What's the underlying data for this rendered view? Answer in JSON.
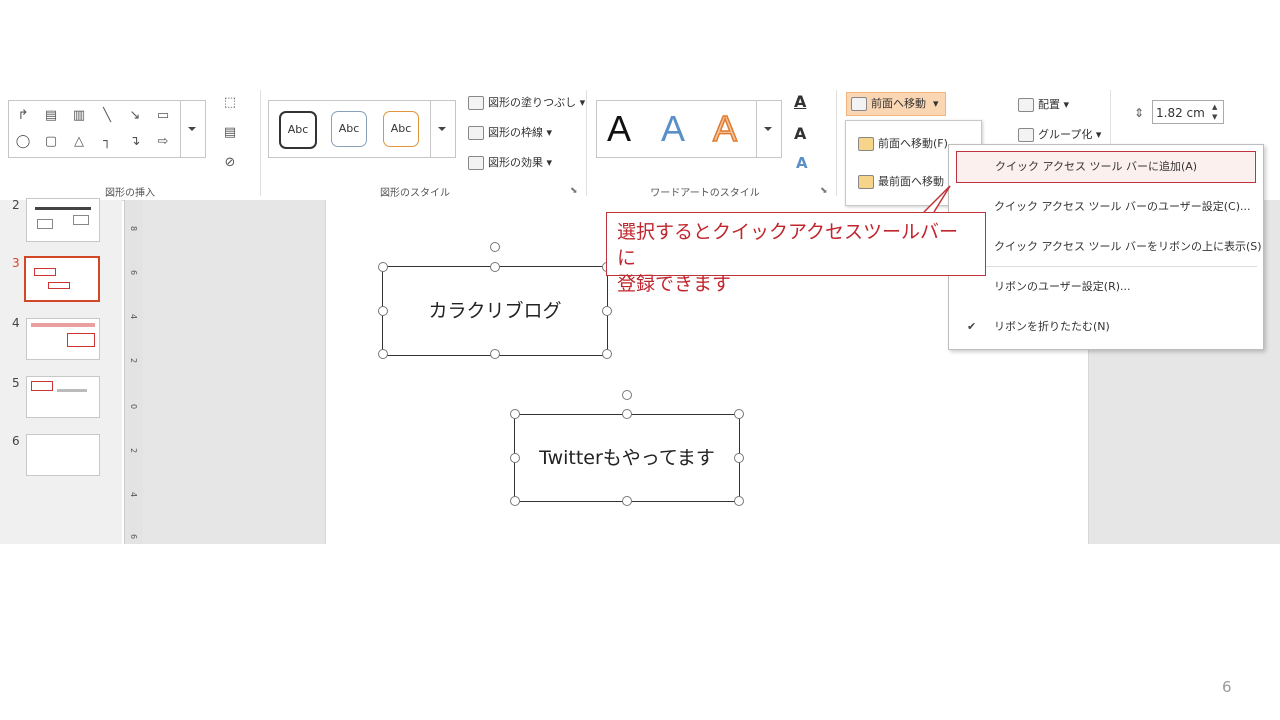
{
  "ribbon": {
    "shape_insert": {
      "group_label": "図形の挿入"
    },
    "shape_styles": {
      "abc_samples": [
        "Abc",
        "Abc",
        "Abc"
      ],
      "fill_label": "図形の塗りつぶし",
      "outline_label": "図形の枠線",
      "effects_label": "図形の効果",
      "group_label": "図形のスタイル"
    },
    "wordart": {
      "samples": [
        "A",
        "A",
        "A"
      ],
      "group_label": "ワードアートのスタイル"
    },
    "arrange": {
      "bring_forward_label": "前面へ移動",
      "align_label": "配置",
      "group_label_btn": "グループ化"
    },
    "size": {
      "height_value": "1.82 cm"
    }
  },
  "bring_forward_menu": {
    "items": [
      "前面へ移動(F)",
      "最前面へ移動"
    ]
  },
  "context_menu": {
    "items": [
      {
        "label": "クイック アクセス ツール バーに追加(A)",
        "highlighted": true,
        "checked": false
      },
      {
        "label": "クイック アクセス ツール バーのユーザー設定(C)...",
        "highlighted": false,
        "checked": false
      },
      {
        "label": "クイック アクセス ツール バーをリボンの上に表示(S)",
        "highlighted": false,
        "checked": false
      },
      {
        "label": "リボンのユーザー設定(R)...",
        "highlighted": false,
        "checked": false
      },
      {
        "label": "リボンを折りたたむ(N)",
        "highlighted": false,
        "checked": true
      }
    ],
    "check_glyph": "✔"
  },
  "callout": {
    "text_line1": "選択するとクイックアクセスツールバーに",
    "text_line2": "登録できます",
    "color": "#c0262d"
  },
  "thumbnails": {
    "numbers": [
      "2",
      "3",
      "4",
      "5",
      "6"
    ],
    "selected": "3",
    "accent": "#d24726"
  },
  "ruler": {
    "ticks": [
      "8",
      "6",
      "4",
      "2",
      "0",
      "2",
      "4",
      "6"
    ]
  },
  "slide": {
    "box1_text": "カラクリブログ",
    "box2_text": "Twitterもやってます"
  },
  "page_number": "6"
}
